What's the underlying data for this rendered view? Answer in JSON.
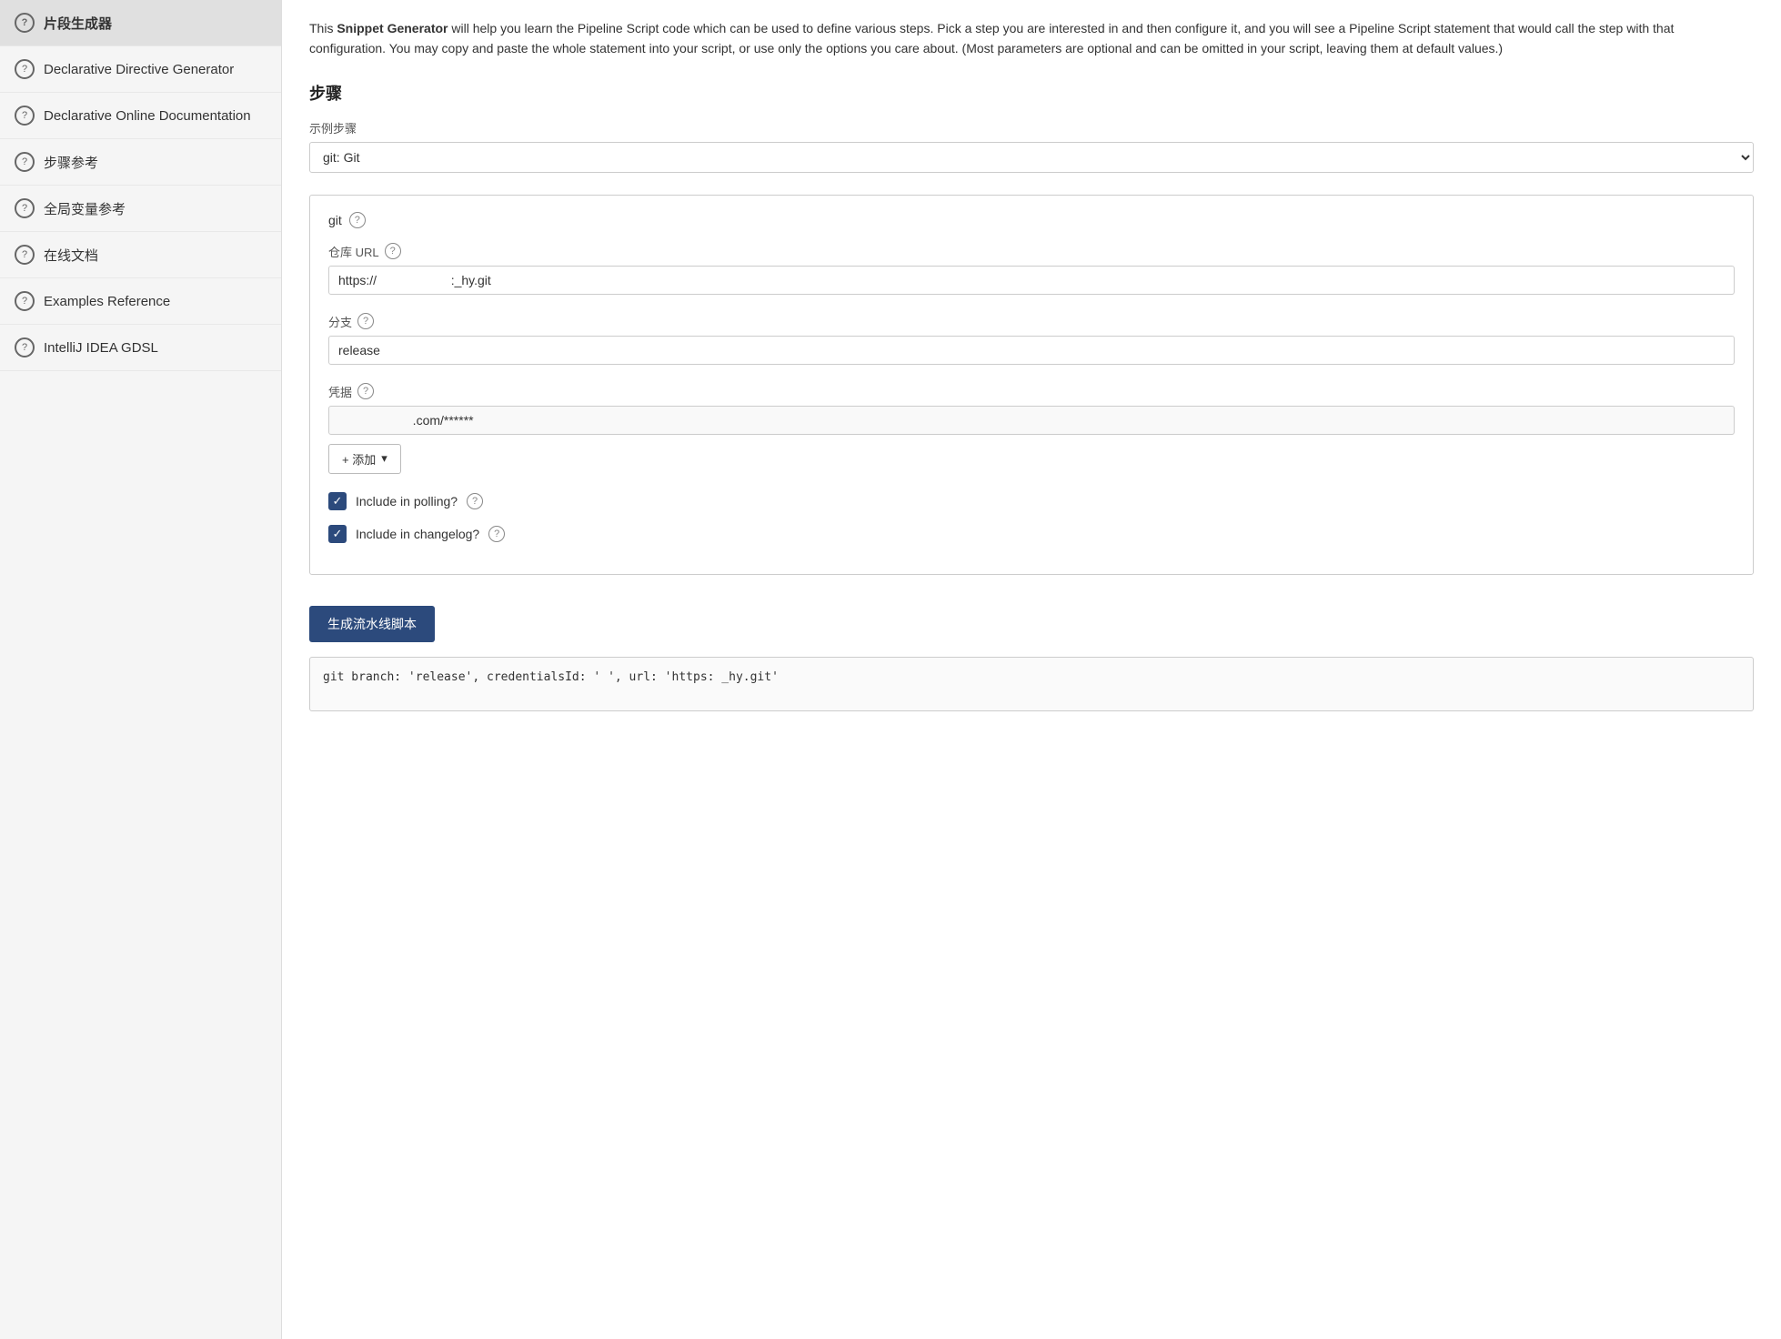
{
  "sidebar": {
    "items": [
      {
        "id": "snippet-generator",
        "label": "片段生成器",
        "active": true
      },
      {
        "id": "declarative-directive-generator",
        "label": "Declarative Directive Generator",
        "active": false
      },
      {
        "id": "declarative-online-documentation",
        "label": "Declarative Online Documentation",
        "active": false
      },
      {
        "id": "step-reference",
        "label": "步骤参考",
        "active": false
      },
      {
        "id": "global-variable-reference",
        "label": "全局变量参考",
        "active": false
      },
      {
        "id": "online-docs",
        "label": "在线文档",
        "active": false
      },
      {
        "id": "examples-reference",
        "label": "Examples Reference",
        "active": false
      },
      {
        "id": "intellij-gdsl",
        "label": "IntelliJ IDEA GDSL",
        "active": false
      }
    ]
  },
  "main": {
    "intro": {
      "prefix": "This ",
      "highlighted": "Snippet Generator",
      "suffix": " will help you learn the Pipeline Script code which can be used to define various steps. Pick a step you are interested in and then configure it, and you will see a Pipeline Script statement that would call the step with that configuration. You may copy and paste the whole statement into your script, or use only the options you care about. (Most parameters are optional and can be omitted in your script, leaving them at default values.)"
    },
    "steps_section": {
      "title": "步骤",
      "sample_step_label": "示例步骤",
      "sample_step_value": "git: Git",
      "sample_step_placeholder": "git: Git"
    },
    "git_box": {
      "header_label": "git",
      "header_help": "?",
      "repo_url_label": "仓库 URL",
      "repo_url_help": "?",
      "repo_url_value": "https://",
      "repo_url_suffix": ":_hy.git",
      "repo_url_placeholder": "https://...:_hy.git",
      "branch_label": "分支",
      "branch_help": "?",
      "branch_value": "release",
      "credentials_label": "凭据",
      "credentials_help": "?",
      "credentials_value": ".com/******",
      "add_button_label": "+ 添加",
      "polling_label": "Include in polling?",
      "polling_help": "?",
      "polling_checked": true,
      "changelog_label": "Include in changelog?",
      "changelog_help": "?",
      "changelog_checked": true
    },
    "generate_button_label": "生成流水线脚本",
    "code_output": "git branch: 'release', credentialsId: '                              ', url: 'https:                        _hy.git'"
  },
  "icons": {
    "question": "?",
    "checkmark": "✓",
    "chevron_down": "▾"
  }
}
